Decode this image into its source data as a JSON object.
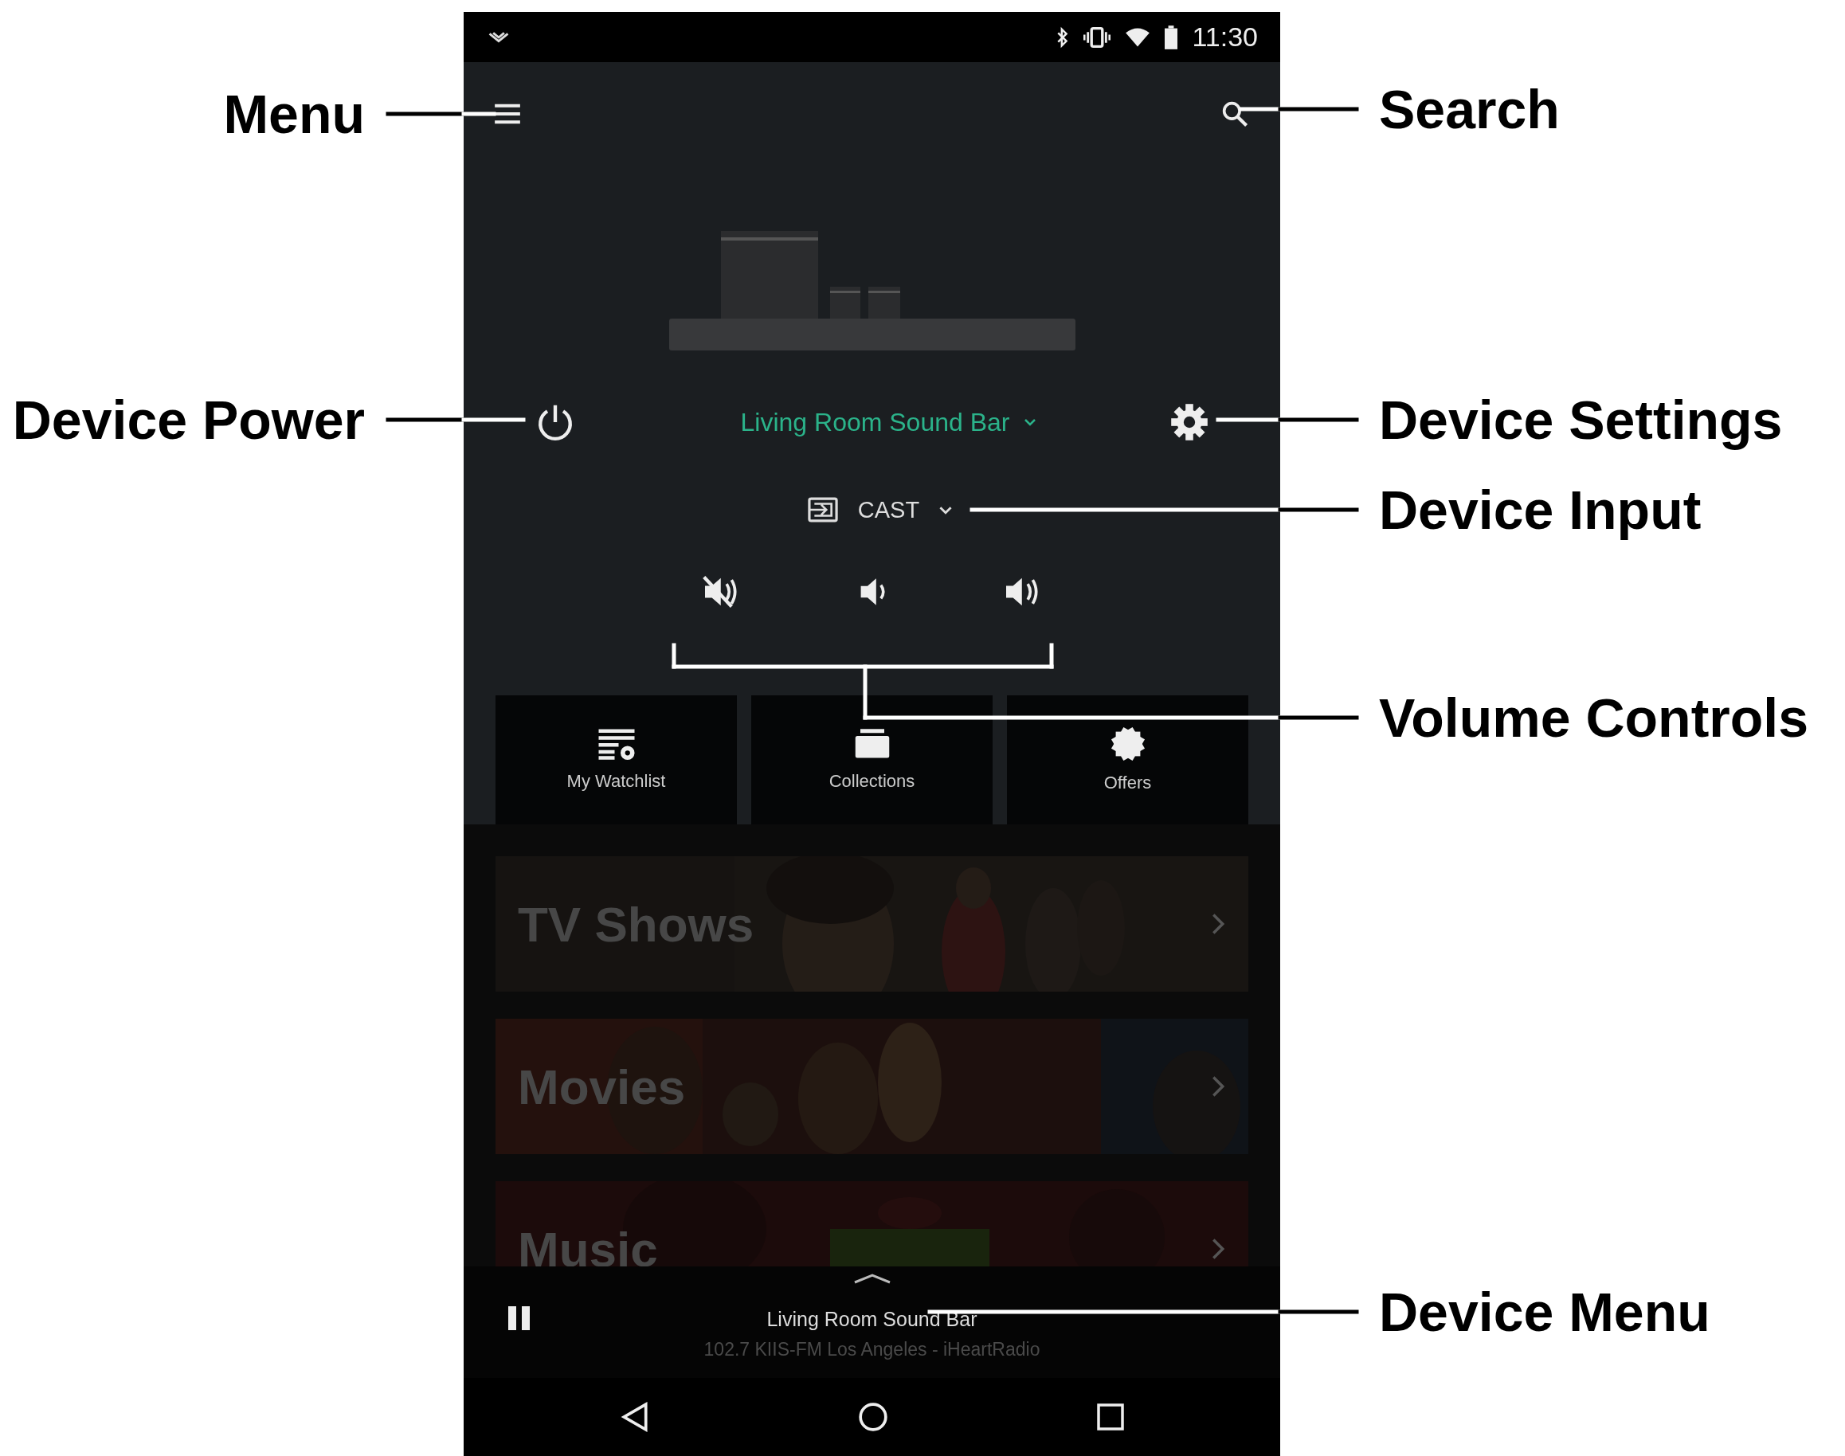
{
  "status_bar": {
    "time": "11:30"
  },
  "device": {
    "name": "Living Room Sound Bar",
    "input": "CAST"
  },
  "shortcuts": [
    {
      "label": "My Watchlist",
      "kind": "watchlist"
    },
    {
      "label": "Collections",
      "kind": "collections"
    },
    {
      "label": "Offers",
      "kind": "offers"
    }
  ],
  "categories": [
    {
      "title": "TV Shows",
      "kind": "picture"
    },
    {
      "title": "Movies",
      "kind": "picture"
    },
    {
      "title": "Music",
      "kind": "picture"
    }
  ],
  "now_playing": {
    "title": "Living Room Sound Bar",
    "subtitle": "102.7 KIIS-FM Los Angeles - iHeartRadio",
    "playing": true
  },
  "callouts": [
    {
      "label": "Menu"
    },
    {
      "label": "Search"
    },
    {
      "label": "Device Power"
    },
    {
      "label": "Device Settings"
    },
    {
      "label": "Device Input"
    },
    {
      "label": "Volume Controls"
    },
    {
      "label": "Device Menu"
    }
  ]
}
